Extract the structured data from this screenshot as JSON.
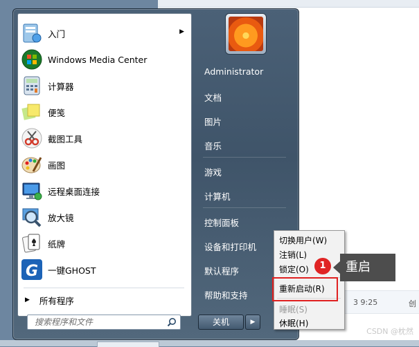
{
  "programs": [
    {
      "label": "入门",
      "icon": "getting-started-icon",
      "has_submenu": true
    },
    {
      "label": "Windows Media Center",
      "icon": "windows-media-center-icon"
    },
    {
      "label": "计算器",
      "icon": "calculator-icon"
    },
    {
      "label": "便笺",
      "icon": "sticky-notes-icon"
    },
    {
      "label": "截图工具",
      "icon": "snipping-tool-icon"
    },
    {
      "label": "画图",
      "icon": "paint-icon"
    },
    {
      "label": "远程桌面连接",
      "icon": "remote-desktop-icon"
    },
    {
      "label": "放大镜",
      "icon": "magnifier-icon"
    },
    {
      "label": "纸牌",
      "icon": "solitaire-icon"
    },
    {
      "label": "一键GHOST",
      "icon": "ghost-icon"
    }
  ],
  "all_programs": "所有程序",
  "search": {
    "placeholder": "搜索程序和文件"
  },
  "right_pane": {
    "user": "Administrator",
    "items": [
      "文档",
      "图片",
      "音乐",
      "游戏",
      "计算机",
      "控制面板",
      "设备和打印机",
      "默认程序",
      "帮助和支持"
    ]
  },
  "shutdown": {
    "label": "关机"
  },
  "submenu": {
    "items": [
      {
        "label": "切换用户(W)",
        "enabled": true
      },
      {
        "label": "注销(L)",
        "enabled": true
      },
      {
        "label": "锁定(O)",
        "enabled": true
      },
      {
        "label": "重新启动(R)",
        "enabled": true
      },
      {
        "label": "睡眠(S)",
        "enabled": false
      },
      {
        "label": "休眠(H)",
        "enabled": true
      }
    ]
  },
  "annotation": {
    "number": "1",
    "text": "重启"
  },
  "background": {
    "time": "3 9:25",
    "label": "创",
    "watermark": "CSDN @枕然"
  },
  "colors": {
    "highlight": "#e02020",
    "badge": "#e02424",
    "callout": "#4d4d4d"
  }
}
